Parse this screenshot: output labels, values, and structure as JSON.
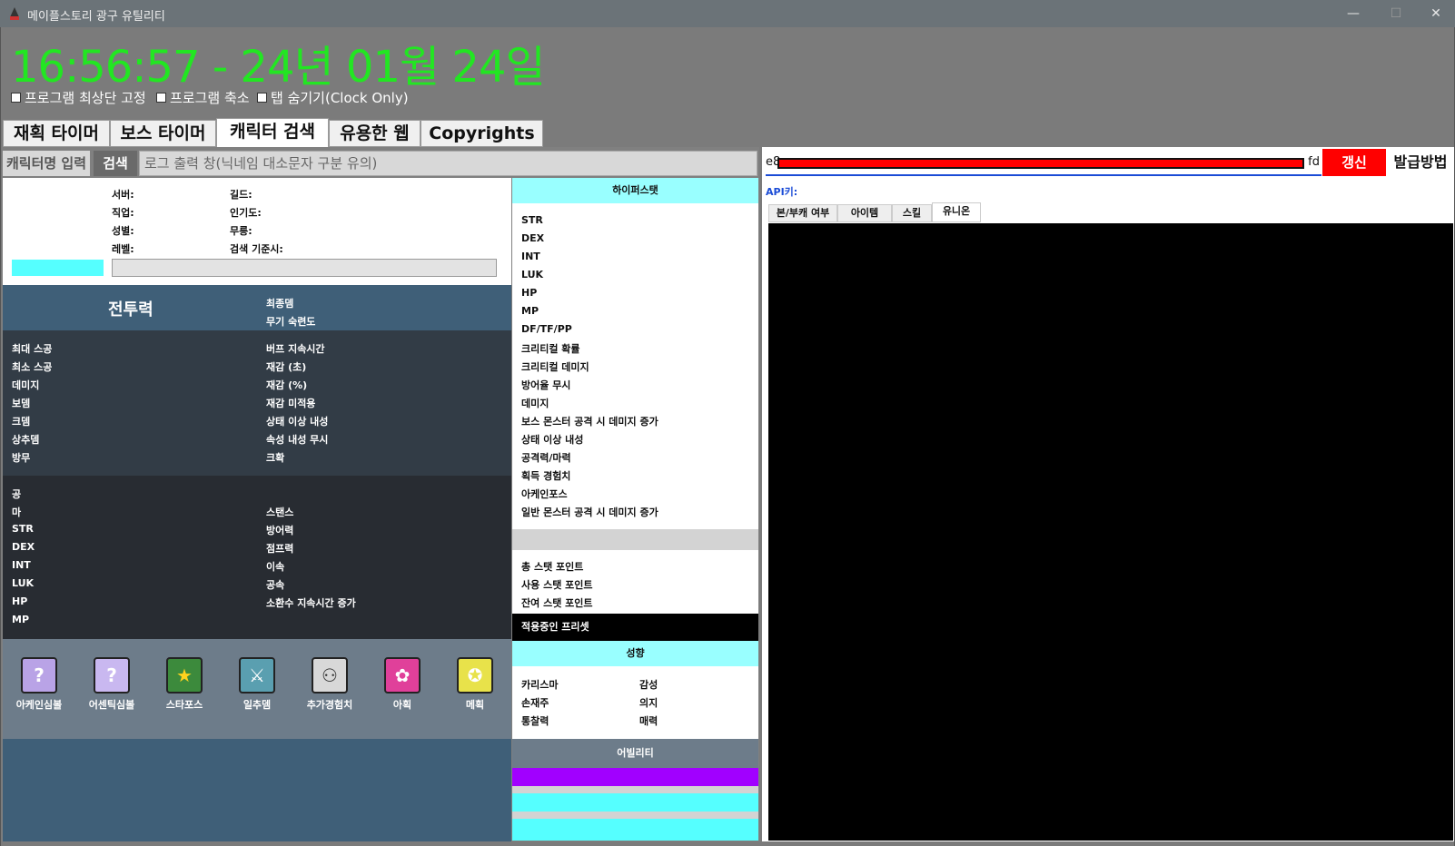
{
  "window": {
    "title": "메이플스토리 광구 유틸리티",
    "minimize": "—",
    "maximize": "☐",
    "close": "✕"
  },
  "clock": "16:56:57 - 24년 01월 24일",
  "options": {
    "always_on_top": "프로그램 최상단 고정",
    "shrink": "프로그램 축소",
    "hide_tabs": "탭 숨기기(Clock Only)"
  },
  "tabs": [
    {
      "label": "재획 타이머"
    },
    {
      "label": "보스 타이머"
    },
    {
      "label": "캐릭터 검색"
    },
    {
      "label": "유용한 웹"
    },
    {
      "label": "Copyrights"
    }
  ],
  "search": {
    "label": "캐릭터명 입력",
    "button": "검색",
    "log": "로그 출력 창(닉네임 대소문자 구분 유의)"
  },
  "profile": {
    "server": "서버:",
    "job": "직업:",
    "gender": "성별:",
    "level": "레벨:",
    "guild": "길드:",
    "popularity": "인기도:",
    "dojang": "무릉:",
    "search_time": "검색 기준시:"
  },
  "combat": {
    "title": "전투력",
    "final_damage": "최종뎀",
    "weapon_mastery": "무기 숙련도"
  },
  "stats1": {
    "left": [
      "최대 스공",
      "최소 스공",
      "데미지",
      "보뎀",
      "크뎀",
      "상추뎀",
      "방무"
    ],
    "right": [
      "버프 지속시간",
      "재감 (초)",
      "재감 (%)",
      "재감 미적용",
      "상태 이상 내성",
      "속성 내성 무시",
      "크확"
    ]
  },
  "stats2": {
    "left": [
      "공",
      "마",
      "STR",
      "DEX",
      "INT",
      "LUK",
      "HP",
      "MP"
    ],
    "right": [
      "스탠스",
      "방어력",
      "점프력",
      "이속",
      "공속",
      "소환수 지속시간 증가"
    ]
  },
  "icons": [
    {
      "label": "아케인심볼",
      "icon": "arcane-symbol-icon",
      "glyph": "?",
      "color": "#b9a3e6"
    },
    {
      "label": "어센틱심볼",
      "icon": "authentic-symbol-icon",
      "glyph": "?",
      "color": "#c9b8f0"
    },
    {
      "label": "스타포스",
      "icon": "starforce-icon",
      "glyph": "★",
      "color": "#3c8a3c"
    },
    {
      "label": "일추뎀",
      "icon": "sword-icon",
      "glyph": "⚔",
      "color": "#5a9fb0"
    },
    {
      "label": "추가경험치",
      "icon": "exp-bonus-icon",
      "glyph": "⚇",
      "color": "#d8d8d8"
    },
    {
      "label": "아획",
      "icon": "drop-icon",
      "glyph": "✿",
      "color": "#e0409a"
    },
    {
      "label": "메획",
      "icon": "meso-icon",
      "glyph": "✪",
      "color": "#e8e24a"
    }
  ],
  "hyper": {
    "title": "하이퍼스탯",
    "items": [
      "STR",
      "DEX",
      "INT",
      "LUK",
      "HP",
      "MP",
      "DF/TF/PP",
      "크리티컬 확률",
      "크리티컬 데미지",
      "방어율 무시",
      "데미지",
      "보스 몬스터 공격 시 데미지 증가",
      "상태 이상 내성",
      "공격력/마력",
      "획득 경험치",
      "아케인포스",
      "일반 몬스터 공격 시 데미지 증가"
    ]
  },
  "stat_points": [
    "총 스탯 포인트",
    "사용 스탯 포인트",
    "잔여 스탯 포인트"
  ],
  "preset": "적용중인 프리셋",
  "traits": {
    "title": "성향",
    "left": [
      "카리스마",
      "손재주",
      "통찰력"
    ],
    "right": [
      "감성",
      "의지",
      "매력"
    ]
  },
  "ability": {
    "title": "어빌리티",
    "colors": [
      "#a100ff",
      "#55ffff",
      "#55ffff"
    ]
  },
  "api": {
    "key_prefix": "e8",
    "key_suffix": "fd",
    "refresh": "갱신",
    "howto": "발급방법",
    "label": "API키:"
  },
  "right_tabs": [
    {
      "label": "본/부캐 여부"
    },
    {
      "label": "아이템"
    },
    {
      "label": "스킬"
    },
    {
      "label": "유니온"
    }
  ]
}
